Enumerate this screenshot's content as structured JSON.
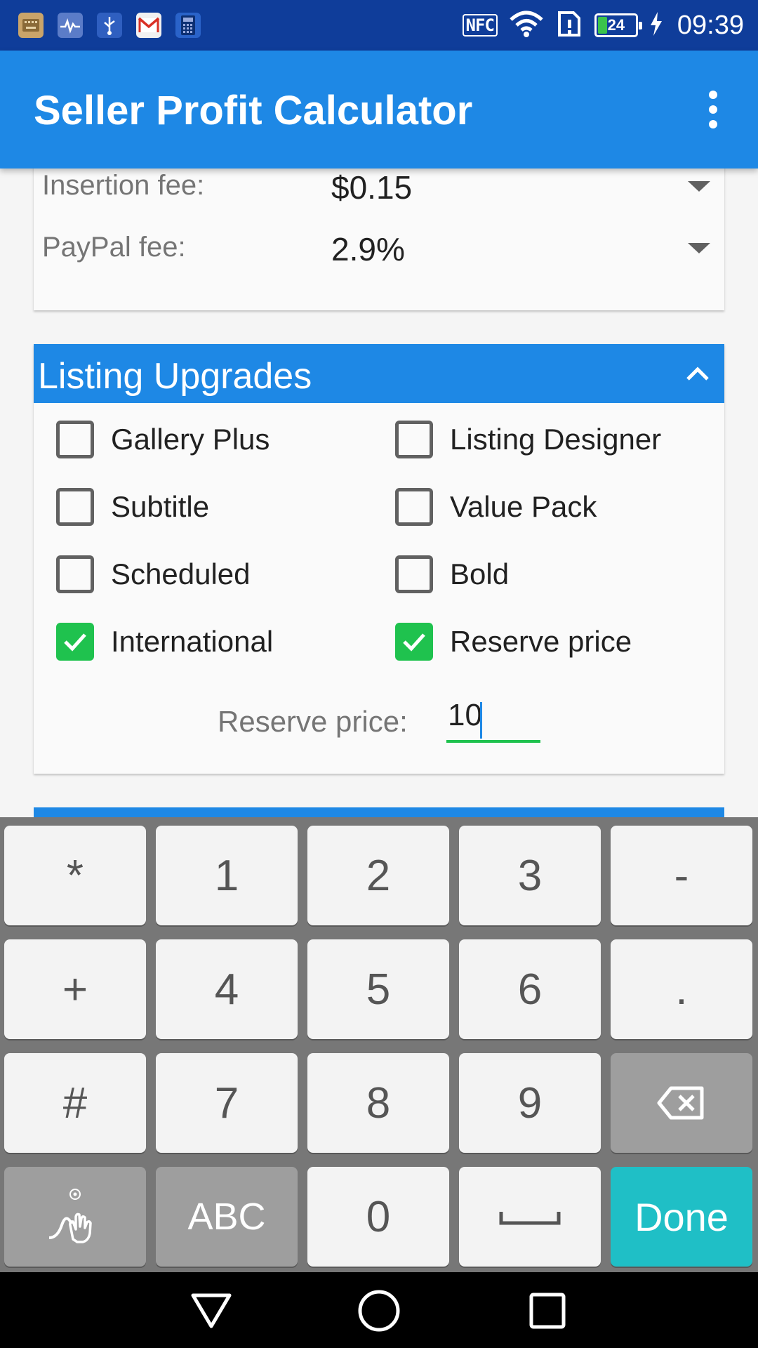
{
  "status_bar": {
    "notification_icons": [
      "keyboard-notification-icon",
      "heart-rate-icon",
      "usb-icon",
      "gmail-icon",
      "calculator-icon"
    ],
    "nfc_label": "NFC",
    "wifi_icon": "wifi-icon",
    "sim_icon": "sim-alert-icon",
    "battery_level": "24",
    "battery_fraction": 0.24,
    "charging_icon": "charging-bolt-icon",
    "time": "09:39"
  },
  "app_bar": {
    "title": "Seller Profit Calculator",
    "menu_icon": "overflow-menu-icon"
  },
  "fees": {
    "insertion_label": "Insertion fee:",
    "insertion_value": "$0.15",
    "paypal_label": "PayPal fee:",
    "paypal_value": "2.9%"
  },
  "listing_upgrades": {
    "title": "Listing Upgrades",
    "options": [
      {
        "label": "Gallery Plus",
        "checked": false
      },
      {
        "label": "Listing Designer",
        "checked": false
      },
      {
        "label": "Subtitle",
        "checked": false
      },
      {
        "label": "Value Pack",
        "checked": false
      },
      {
        "label": "Scheduled",
        "checked": false
      },
      {
        "label": "Bold",
        "checked": false
      },
      {
        "label": "International",
        "checked": true
      },
      {
        "label": "Reserve price",
        "checked": true
      }
    ],
    "reserve_price_label": "Reserve price:",
    "reserve_price_value": "10"
  },
  "keyboard": {
    "rows": [
      [
        "*",
        "1",
        "2",
        "3",
        "-"
      ],
      [
        "+",
        "4",
        "5",
        "6",
        "."
      ],
      [
        "#",
        "7",
        "8",
        "9",
        "backspace"
      ],
      [
        "handwriting",
        "ABC",
        "0",
        "space",
        "Done"
      ]
    ],
    "done_label": "Done",
    "abc_label": "ABC"
  },
  "nav_bar": {
    "back_icon": "back-icon",
    "home_icon": "home-icon",
    "recents_icon": "recents-icon"
  },
  "colors": {
    "status_bar": "#0f3d9a",
    "app_bar": "#1e88e5",
    "accent_green": "#1fc24e",
    "done_key": "#1fbfc6",
    "keyboard_bg": "#777777"
  }
}
